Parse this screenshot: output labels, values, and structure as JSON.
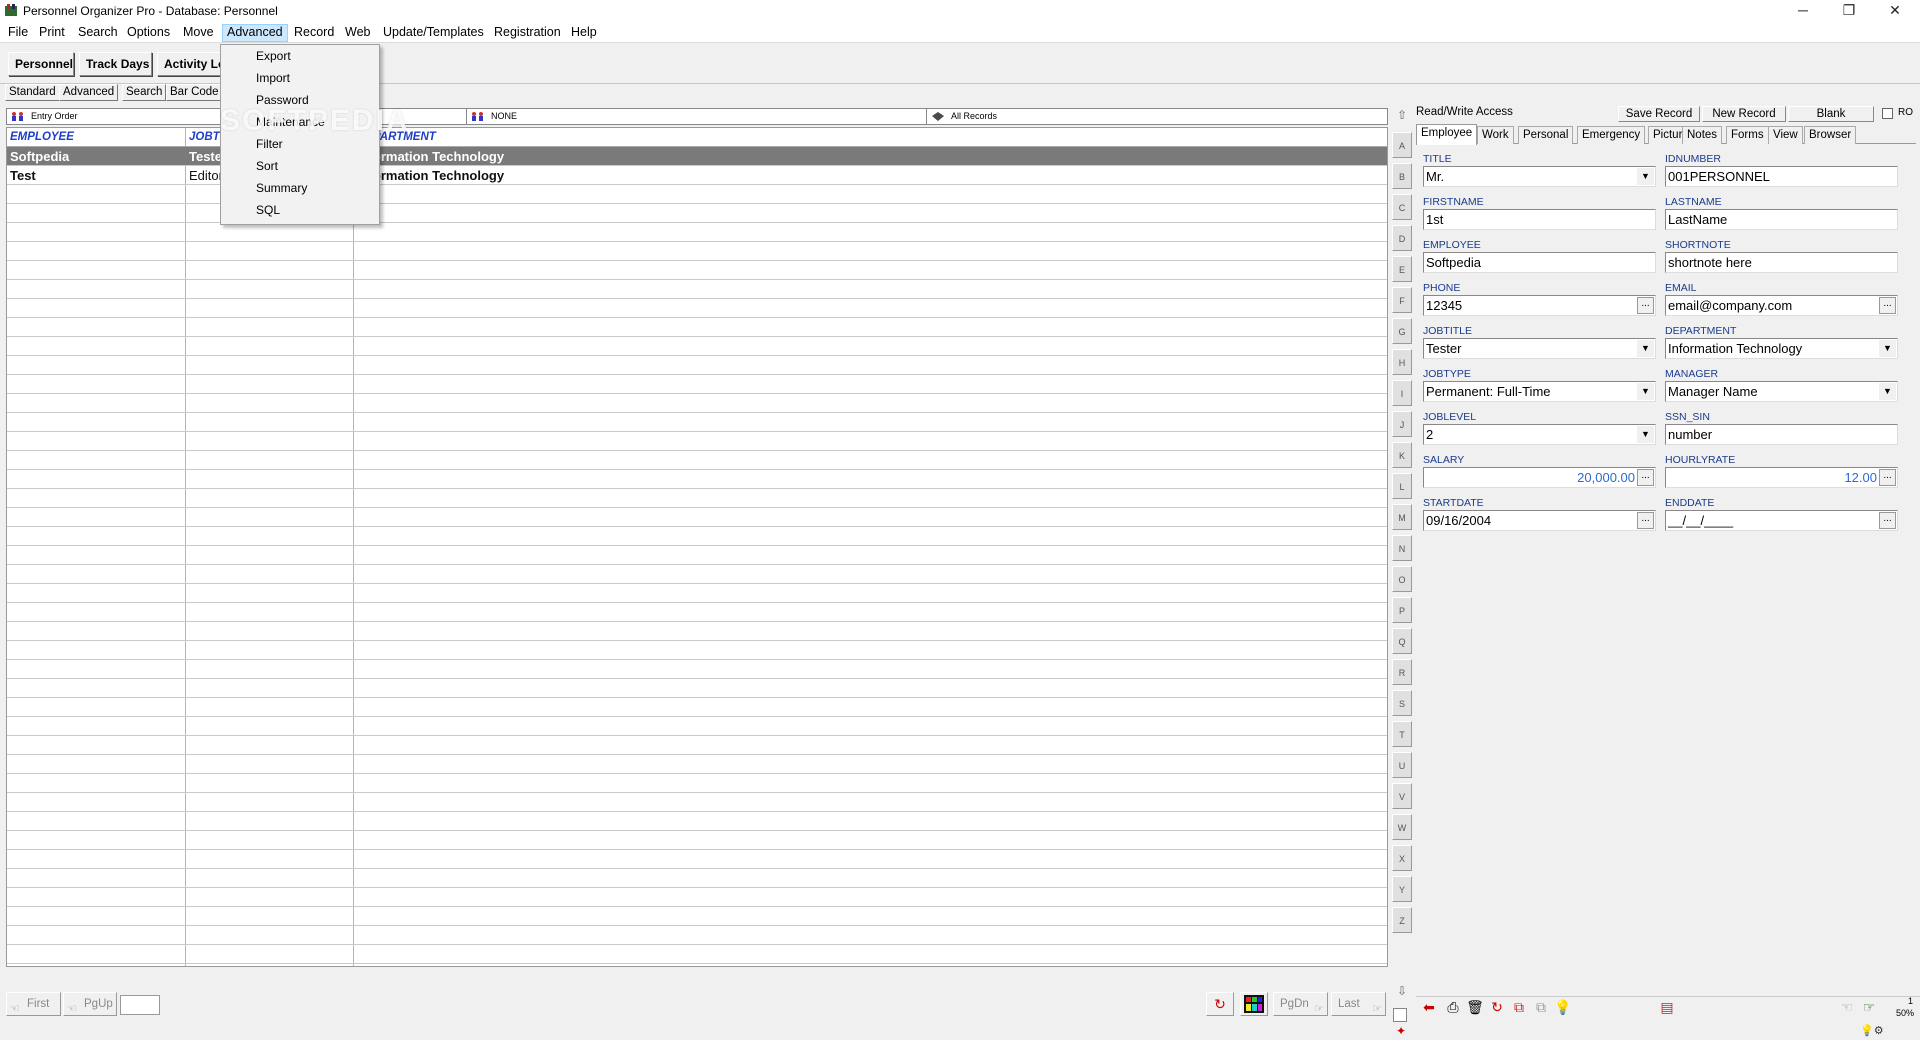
{
  "window": {
    "title": "Personnel Organizer Pro - Database: Personnel",
    "minimize": "─",
    "restore": "❐",
    "close": "✕"
  },
  "menubar": [
    "File",
    "Print",
    "Search",
    "Options",
    "Move",
    "Advanced",
    "Record",
    "Web",
    "Update/Templates",
    "Registration",
    "Help"
  ],
  "advanced_menu": [
    "Export",
    "Import",
    "Password",
    "Maintenance",
    "Filter",
    "Sort",
    "Summary",
    "SQL"
  ],
  "watermark": "SOFTPEDIA",
  "toolbar": {
    "personnel": "Personnel",
    "track_days": "Track Days",
    "activity_log": "Activity Log"
  },
  "subtabs": [
    "Standard",
    "Advanced",
    "Search",
    "Bar Code"
  ],
  "filterbar": {
    "order": "Entry Order",
    "filter": "NONE",
    "records": "All Records"
  },
  "grid": {
    "columns": [
      "EMPLOYEE",
      "JOBTITLE",
      "DEPARTMENT"
    ],
    "rows": [
      {
        "employee": "Softpedia",
        "jobtitle": "Tester",
        "department": "Information Technology"
      },
      {
        "employee": "Test",
        "jobtitle": "Editor",
        "department": "Information Technology"
      }
    ]
  },
  "alpha_index": [
    "A",
    "B",
    "C",
    "D",
    "E",
    "F",
    "G",
    "H",
    "I",
    "J",
    "K",
    "L",
    "M",
    "N",
    "O",
    "P",
    "Q",
    "R",
    "S",
    "T",
    "U",
    "V",
    "W",
    "X",
    "Y",
    "Z"
  ],
  "leftnav": {
    "first": "First",
    "pgup": "PgUp",
    "pgdn": "PgDn",
    "last": "Last"
  },
  "detail": {
    "access": "Read/Write Access",
    "save": "Save Record",
    "new": "New Record",
    "blank": "Blank",
    "ro": "RO",
    "tabs": [
      "Employee",
      "Work",
      "Personal",
      "Emergency",
      "Picture",
      "Notes",
      "Forms",
      "View",
      "Browser"
    ],
    "fields": {
      "title": {
        "label": "TITLE",
        "value": "Mr."
      },
      "idnumber": {
        "label": "IDNUMBER",
        "value": "001PERSONNEL"
      },
      "firstname": {
        "label": "FIRSTNAME",
        "value": "1st"
      },
      "lastname": {
        "label": "LASTNAME",
        "value": "LastName"
      },
      "employee": {
        "label": "EMPLOYEE",
        "value": "Softpedia"
      },
      "shortnote": {
        "label": "SHORTNOTE",
        "value": "shortnote here"
      },
      "phone": {
        "label": "PHONE",
        "value": "12345"
      },
      "email": {
        "label": "EMAIL",
        "value": "email@company.com"
      },
      "jobtitle": {
        "label": "JOBTITLE",
        "value": "Tester"
      },
      "department": {
        "label": "DEPARTMENT",
        "value": "Information Technology"
      },
      "jobtype": {
        "label": "JOBTYPE",
        "value": "Permanent: Full-Time"
      },
      "manager": {
        "label": "MANAGER",
        "value": "Manager Name"
      },
      "joblevel": {
        "label": "JOBLEVEL",
        "value": "2"
      },
      "ssn": {
        "label": "SSN_SIN",
        "value": "number"
      },
      "salary": {
        "label": "SALARY",
        "value": "20,000.00"
      },
      "hourlyrate": {
        "label": "HOURLYRATE",
        "value": "12.00"
      },
      "startdate": {
        "label": "STARTDATE",
        "value": "09/16/2004"
      },
      "enddate": {
        "label": "ENDDATE",
        "value": "__/__/____"
      }
    },
    "ellipsis": "...",
    "dropdown_arrow": "▼"
  },
  "status": {
    "page": "1",
    "zoom": "50%"
  },
  "colors": {
    "label_blue": "#1a3b8c",
    "header_blue": "#1f3fc8",
    "selected_row": "#7a7a7a",
    "menu_highlight": "#cce8ff"
  }
}
